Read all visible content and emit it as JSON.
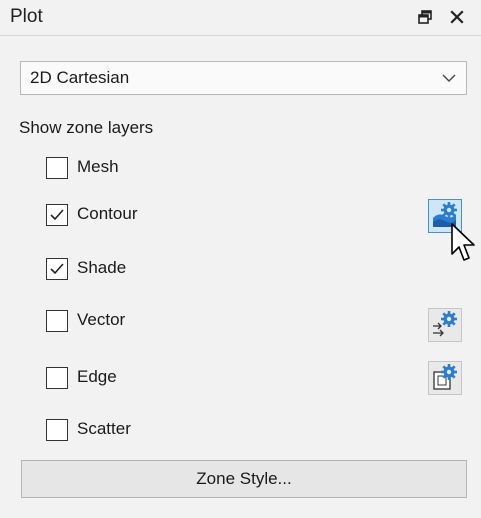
{
  "panel": {
    "title": "Plot",
    "float_icon": "float-window-icon",
    "close_icon": "close-icon"
  },
  "plot_type": {
    "value": "2D Cartesian"
  },
  "zone_layers": {
    "heading": "Show zone layers",
    "items": [
      {
        "label": "Mesh",
        "checked": false
      },
      {
        "label": "Contour",
        "checked": true,
        "settings_icon": "contour-settings-icon",
        "settings_active": true
      },
      {
        "label": "Shade",
        "checked": true
      },
      {
        "label": "Vector",
        "checked": false,
        "settings_icon": "vector-settings-icon"
      },
      {
        "label": "Edge",
        "checked": false,
        "settings_icon": "edge-settings-icon"
      },
      {
        "label": "Scatter",
        "checked": false
      }
    ]
  },
  "zone_style_button": {
    "label": "Zone Style..."
  },
  "colors": {
    "panel_bg": "#f2f2f2",
    "active_button_bg": "#cfe6f8",
    "gear_blue": "#2a7dd1"
  }
}
